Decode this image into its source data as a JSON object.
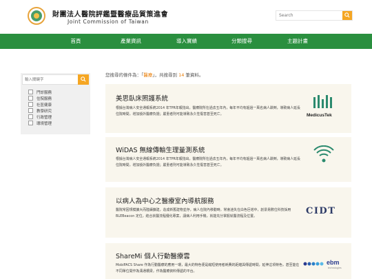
{
  "header": {
    "title_zh": "財團法人醫院評鑑暨醫療品質策進會",
    "title_en": "Joint Commission of Taiwan",
    "search_placeholder": "Search"
  },
  "nav": {
    "items": [
      {
        "label": "首頁"
      },
      {
        "label": "產業資訊"
      },
      {
        "label": "導入實績"
      },
      {
        "label": "分類搜尋"
      },
      {
        "label": "主題計畫"
      }
    ]
  },
  "sidebar": {
    "search_placeholder": "輸入關鍵字",
    "categories": [
      {
        "label": "門診服務"
      },
      {
        "label": "住院服務"
      },
      {
        "label": "社區健康"
      },
      {
        "label": "教學研究"
      },
      {
        "label": "行政管理"
      },
      {
        "label": "環境管理"
      }
    ]
  },
  "results": {
    "prefix": "您搜尋的條件為：「",
    "keyword": "醫療",
    "middle": "」，共搜尋到 ",
    "count": "14",
    "suffix": " 筆資料。",
    "cards": [
      {
        "title": "美思臥床照護系統",
        "desc": "根據台灣病人安全通報系統2014 年TPR年報指出，醫療院所在過去五年內，每年平均有超過一萬名病人跌倒，導致病人延長住院時間，增加額外醫療負擔；嚴重者則可能導致永久性傷害甚至死亡。",
        "logo_text": "MedicusTek",
        "logo_icon": "medicustek-logo"
      },
      {
        "title": "WiDAS 無線傳輸生理量測系統",
        "desc": "根據台灣病人安全通報系統2014 年TPR年報指出，醫療院所在過去五年內，每年平均有超過一萬名病人跌倒，導致病人延長住院時間，增加額外醫療負擔；嚴重者則可能導致永久性傷害甚至死亡。",
        "logo_icon": "widas-logo"
      },
      {
        "title": "以病人為中心之醫療室內導航服務",
        "desc": "醫院常因規模擴大而陸續擴建，造成新舊建物並存，病人在院內移動時，常會迷失在白色巨塔中，創景易數位科技採用BLEBeacon 定位，結合就醫流程優化專案，讓病人利用手機，就能充分掌握就醫流程及位置。",
        "logo_text": "CIDT",
        "logo_icon": "cidt-logo"
      },
      {
        "title": "ShareMi 個人行動醫療雲",
        "desc": "MobiPACS Share 作為行動醫療的應用一環，最大的特色便是縮短使用者耗費的距離與傳遞時間，延伸這項特色，甚至能在不同單位間作為溝通橋梁，作為醫療資料傳遞的平台。",
        "logo_text": "ebm",
        "logo_sub": "technologies",
        "logo_icon": "ebm-logo"
      }
    ]
  },
  "colors": {
    "nav_green": "#2a8f3f",
    "accent_orange": "#f5a623",
    "card_bg": "#f9f6ed",
    "highlight": "#e87a00"
  }
}
